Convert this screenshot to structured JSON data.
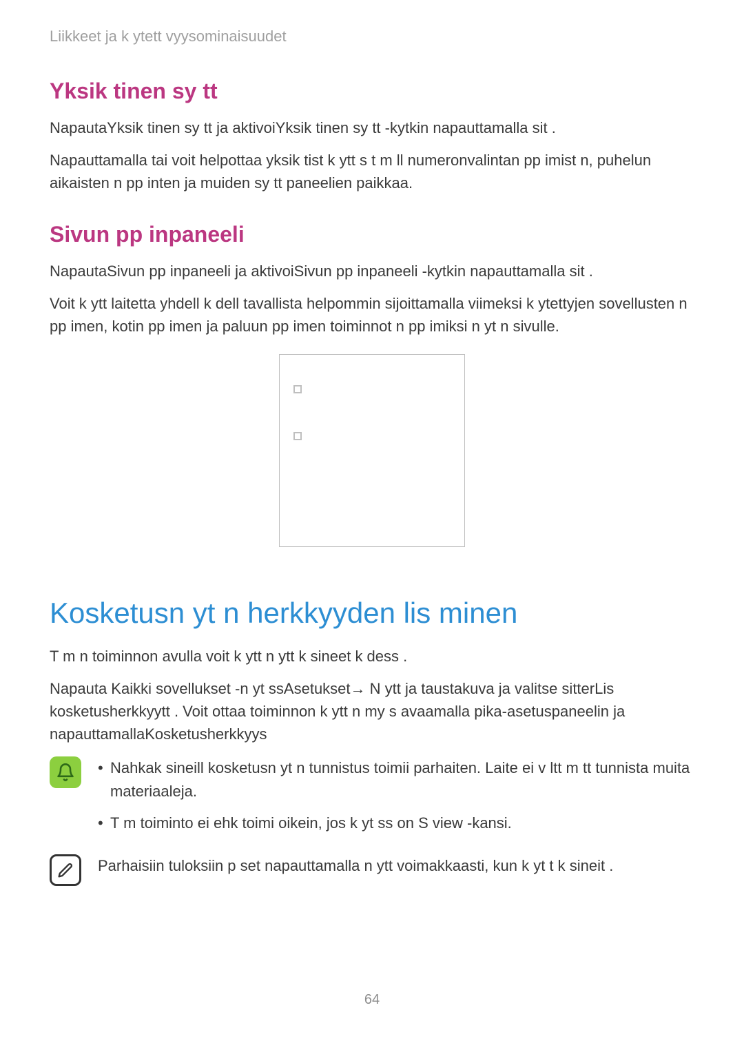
{
  "breadcrumb": "Liikkeet ja k ytett vyysominaisuudet",
  "section1": {
    "heading": "Yksik tinen sy tt",
    "p1": "NapautaYksik tinen sy tt     ja aktivoiYksik tinen sy tt    -kytkin napauttamalla sit .",
    "p2": "Napauttamalla   tai   voit helpottaa yksik tist  k ytt  s  t m ll numeronvalintan pp imist n, puhelun aikaisten n pp inten ja muiden sy tt paneelien paikkaa."
  },
  "section2": {
    "heading": "Sivun pp inpaneeli",
    "p1": "NapautaSivun pp inpaneeli   ja aktivoiSivun pp inpaneeli  -kytkin napauttamalla sit .",
    "p2": "Voit k ytt  laitetta yhdell  k dell  tavallista helpommin sijoittamalla viimeksi k ytettyjen sovellusten n pp imen, kotin pp imen ja paluun pp imen toiminnot n pp imiksi n yt n sivulle."
  },
  "main": {
    "heading": "Kosketusn yt n herkkyyden lis  minen",
    "p1": "T m n toiminnon avulla voit k ytt  n ytt  k sineet k dess .",
    "p2": "Napauta Kaikki sovellukset -n yt ssAsetukset→ N ytt  ja taustakuva   ja valitse sitterLis kosketusherkkyytt  . Voit ottaa toiminnon k ytt  n my s avaamalla pika-asetuspaneelin ja napauttamallaKosketusherkkyys"
  },
  "bullets": [
    "Nahkak sineill  kosketusn yt n tunnistus toimii parhaiten. Laite ei v ltt m tt tunnista muita materiaaleja.",
    "T m  toiminto ei ehk  toimi oikein, jos k yt ss  on S view -kansi."
  ],
  "memo": "Parhaisiin tuloksiin p  set napauttamalla n ytt  voimakkaasti, kun k yt t k sineit .",
  "page_number": "64"
}
